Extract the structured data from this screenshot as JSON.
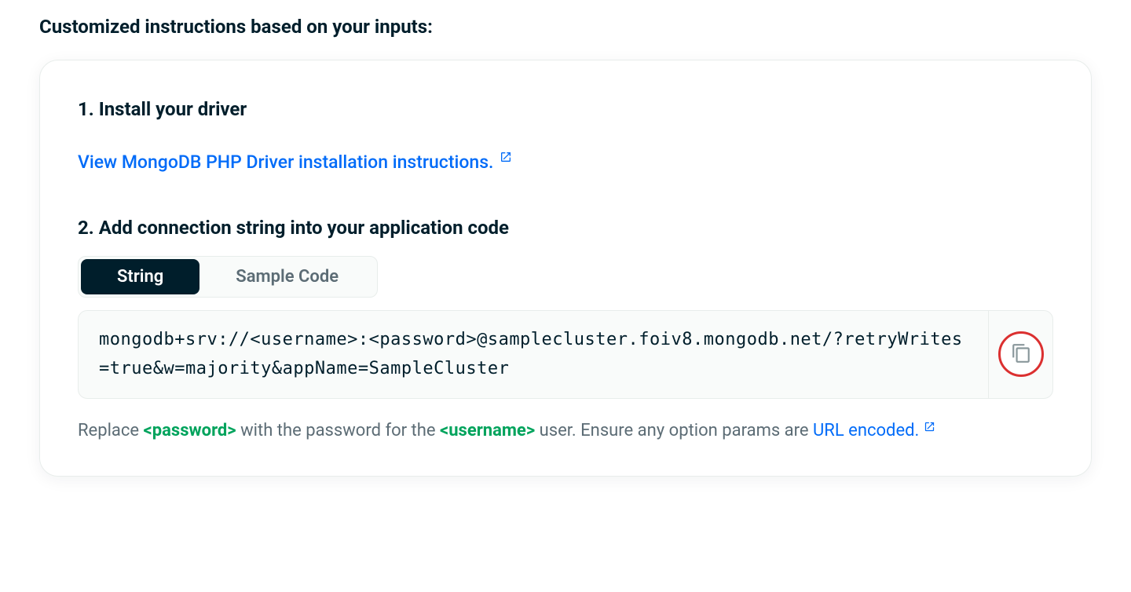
{
  "heading": "Customized instructions based on your inputs:",
  "step1": {
    "title": "1. Install your driver",
    "linkText": "View MongoDB PHP Driver installation instructions."
  },
  "step2": {
    "title": "2. Add connection string into your application code",
    "toggle": {
      "string": "String",
      "sample": "Sample Code"
    },
    "code": "mongodb+srv://<username>:<password>@samplecluster.foiv8.mongodb.net/?retryWrites=true&w=majority&appName=SampleCluster",
    "hint": {
      "part1": "Replace ",
      "token1": "<password>",
      "part2": " with the password for the ",
      "token2": "<username>",
      "part3": " user. Ensure any option params are ",
      "linkText": "URL encoded."
    }
  }
}
